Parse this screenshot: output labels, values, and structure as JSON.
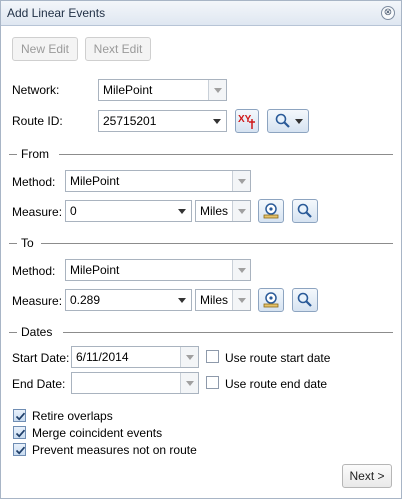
{
  "window": {
    "title": "Add Linear Events",
    "close_glyph": "⊗"
  },
  "toolbar": {
    "new_edit": "New Edit",
    "next_edit": "Next Edit"
  },
  "network": {
    "label": "Network:",
    "value": "MilePoint"
  },
  "route": {
    "label": "Route ID:",
    "value": "25715201"
  },
  "from": {
    "heading": "From",
    "method_label": "Method:",
    "method_value": "MilePoint",
    "measure_label": "Measure:",
    "measure_value": "0",
    "units": "Miles"
  },
  "to": {
    "heading": "To",
    "method_label": "Method:",
    "method_value": "MilePoint",
    "measure_label": "Measure:",
    "measure_value": "0.289",
    "units": "Miles"
  },
  "dates": {
    "heading": "Dates",
    "start_label": "Start Date:",
    "start_value": "6/11/2014",
    "use_start_label": "Use route start date",
    "end_label": "End Date:",
    "end_value": "",
    "use_end_label": "Use route end date"
  },
  "options": {
    "retire_overlaps": "Retire overlaps",
    "merge_coincident": "Merge coincident events",
    "prevent_measures": "Prevent measures not on route"
  },
  "footer": {
    "next": "Next >"
  },
  "colors": {
    "xy_red": "#d01818",
    "accent_blue": "#2a5a98"
  }
}
